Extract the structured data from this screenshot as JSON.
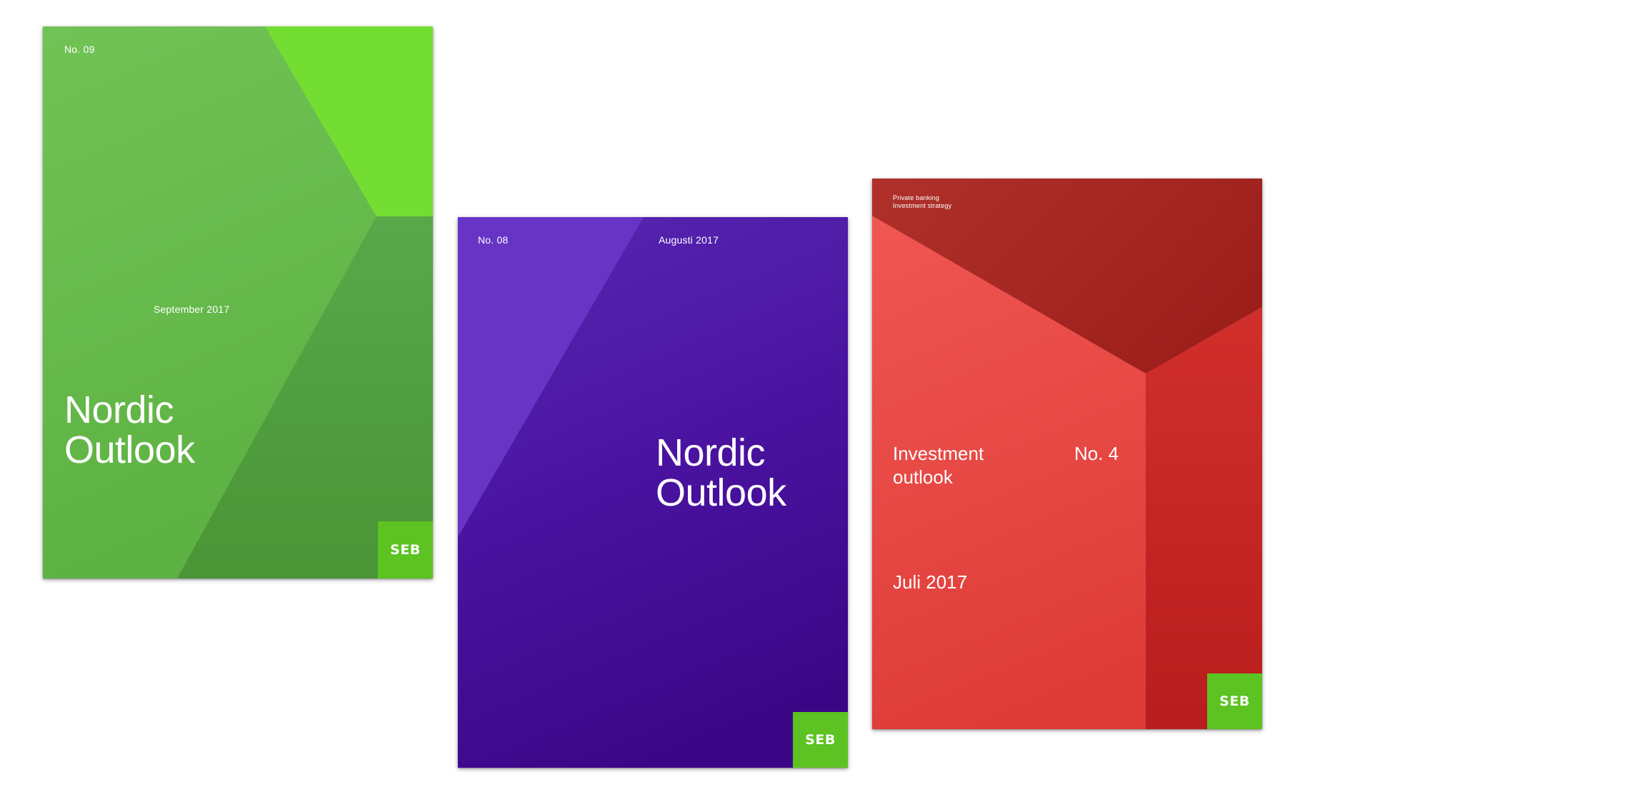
{
  "covers": [
    {
      "number": "No. 09",
      "date": "September 2017",
      "title_line1": "Nordic",
      "title_line2": "Outlook",
      "logo": "SEB",
      "colors": {
        "base": "#6cc04f",
        "accent": "#74e030",
        "dark": "#4e9e3c"
      }
    },
    {
      "number": "No. 08",
      "date": "Augusti 2017",
      "title_line1": "Nordic",
      "title_line2": "Outlook",
      "logo": "SEB",
      "colors": {
        "base": "#4f1aa5",
        "accent": "#6a35c8",
        "dark": "#3a0788"
      }
    },
    {
      "header_line1": "Private banking",
      "header_line2": "Investment strategy",
      "title_line1": "Investment",
      "title_line2": "outlook",
      "number": "No. 4",
      "date": "Juli 2017",
      "logo": "SEB",
      "colors": {
        "base": "#f05552",
        "top": "#a6231f",
        "right": "#cc2a26"
      }
    }
  ],
  "logo_color": "#5cc322"
}
